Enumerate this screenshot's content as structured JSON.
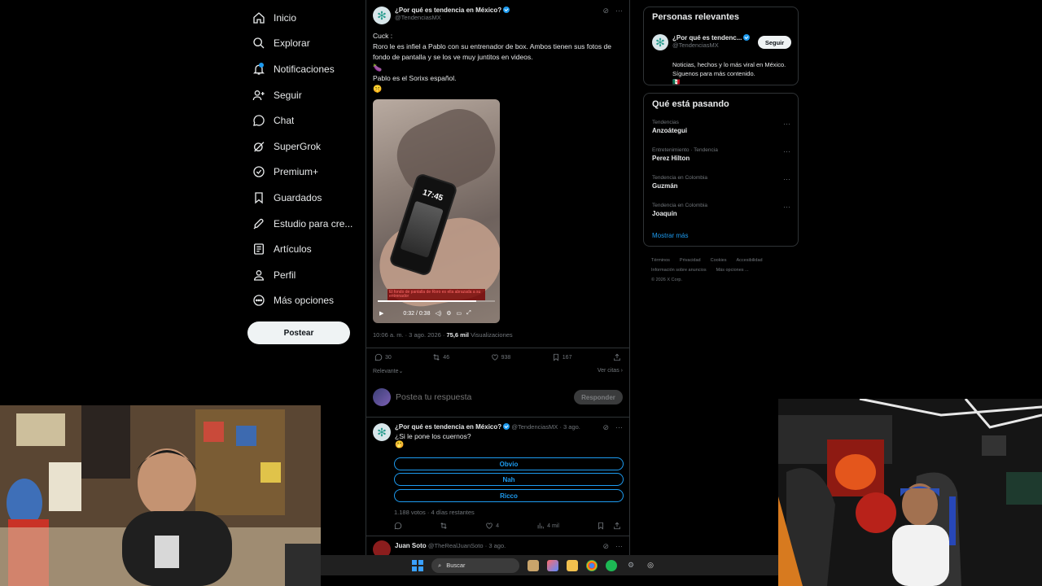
{
  "nav": {
    "items": [
      {
        "label": "Inicio",
        "icon": "home-icon"
      },
      {
        "label": "Explorar",
        "icon": "search-icon"
      },
      {
        "label": "Notificaciones",
        "icon": "bell-icon"
      },
      {
        "label": "Seguir",
        "icon": "follow-icon"
      },
      {
        "label": "Chat",
        "icon": "chat-icon"
      },
      {
        "label": "SuperGrok",
        "icon": "grok-icon"
      },
      {
        "label": "Premium+",
        "icon": "premium-icon"
      },
      {
        "label": "Guardados",
        "icon": "bookmark-icon"
      },
      {
        "label": "Estudio para cre...",
        "icon": "rocket-icon"
      },
      {
        "label": "Artículos",
        "icon": "article-icon"
      },
      {
        "label": "Perfil",
        "icon": "person-icon"
      },
      {
        "label": "Más opciones",
        "icon": "more-icon"
      }
    ],
    "post_button": "Postear"
  },
  "tweet": {
    "name": "¿Por qué es tendencia en México?",
    "handle": "@TendenciasMX",
    "text1": "Cuck :\nRoro le es infiel a Pablo con su entrenador de box. Ambos tienen sus fotos de fondo de pantalla y se los ve muy juntitos en videos.",
    "emoji1": "🍆",
    "text2": "Pablo es el Sorixs español.",
    "emoji2": "🤫",
    "video": {
      "phone_time": "17:45",
      "caption": "El fondo de pantalla de Roro es ella abrazada a su entrenador",
      "time": "0:32 / 0:38",
      "progress": 0.84
    },
    "timestamp": "10:06 a. m. · 3 ago. 2026 ·",
    "views_value": "75,6 mil",
    "views_label": "Visualizaciones",
    "replies": "30",
    "reposts": "46",
    "likes": "938",
    "bookmarks": "167",
    "sort_label": "Relevante",
    "quotes_label": "Ver citas"
  },
  "reply_box": {
    "placeholder": "Postea tu respuesta",
    "button": "Responder"
  },
  "poll_tweet": {
    "name": "¿Por qué es tendencia en México?",
    "handle": "@TendenciasMX",
    "date": "· 3 ago.",
    "question": "¿Si le pone los cuernos?",
    "emoji": "🤭",
    "options": [
      "Obvio",
      "Nah",
      "Ricco"
    ],
    "meta": "1.188 votos · 4 días restantes",
    "likes": "4",
    "views": "4 mil"
  },
  "third_tweet": {
    "name": "Juan Soto",
    "handle": "@TheRealJuanSoto",
    "date": "· 3 ago."
  },
  "relevant": {
    "title": "Personas relevantes",
    "name": "¿Por qué es tendenc...",
    "handle": "@TendenciasMX",
    "follow": "Seguir",
    "bio": "Noticias, hechos y lo más viral en México. Síguenos para más contenido.",
    "flag": "🇲🇽"
  },
  "trends": {
    "title": "Qué está pasando",
    "items": [
      {
        "category": "Tendencias",
        "name": "Anzoátegui"
      },
      {
        "category": "Entretenimiento · Tendencia",
        "name": "Perez Hilton"
      },
      {
        "category": "Tendencia en Colombia",
        "name": "Guzmán"
      },
      {
        "category": "Tendencia en Colombia",
        "name": "Joaquín"
      }
    ],
    "show_more": "Mostrar más"
  },
  "footer": {
    "links": [
      "Términos",
      "Privacidad",
      "Cookies",
      "Accesibilidad",
      "Información sobre anuncios",
      "Más opciones ..."
    ],
    "copyright": "© 2026 X Corp."
  },
  "taskbar": {
    "search": "Buscar"
  },
  "colors": {
    "accent": "#1d9bf0",
    "background": "#000000",
    "border": "#2f3336",
    "muted": "#71767b"
  }
}
